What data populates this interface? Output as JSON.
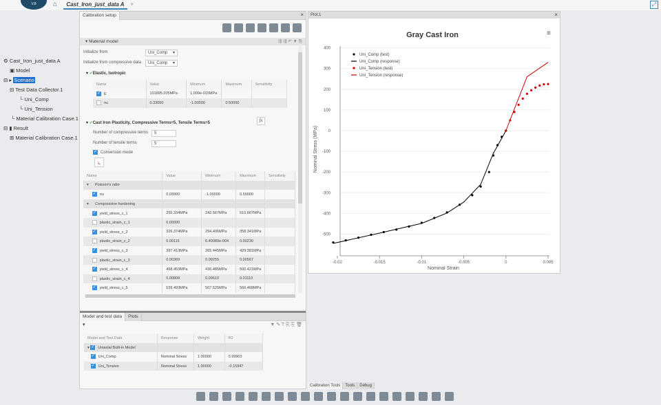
{
  "app": {
    "logo_text": "V.8",
    "doc_tab": "Cast_Iron_just_data A"
  },
  "tree": {
    "root": "Cast_Iron_just_data A",
    "items": [
      "Model",
      "Scenario",
      "Test Data Collector.1",
      "Uni_Comp",
      "Uni_Tension",
      "Material Calibration Case.1",
      "Result",
      "Material Calibration Case.1"
    ]
  },
  "calibration": {
    "tab": "Calibration setup",
    "section": "Material model",
    "init_from_label": "Initialize from",
    "init_from_value": "Uni_Comp",
    "init_comp_label": "Initialize from compressive data",
    "init_comp_value": "Uni_Comp",
    "elastic_title": "Elastic, Isotropic",
    "columns": [
      "Name",
      "Value",
      "Minimum",
      "Maximum",
      "Sensitivity"
    ],
    "elastic_rows": [
      {
        "name": "E",
        "value": "101895.205MPa",
        "min": "1.000e-015MPa",
        "max": "",
        "checked": true
      },
      {
        "name": "nu",
        "value": "0.33000",
        "min": "-1.00000",
        "max": "0.50000",
        "checked": false
      }
    ],
    "plasticity_title": "Cast Iron Plasticity, Compressive Terms=5, Tensile Terms=5",
    "fx": "fx",
    "n_comp_label": "Number of compressive terms",
    "n_comp": "5",
    "n_tens_label": "Number of tensile terms",
    "n_tens": "5",
    "conversion_label": "Conversion mode",
    "plast_rows": [
      {
        "group": "Poisson's ratio"
      },
      {
        "name": "nu",
        "value": "0.03900",
        "min": "-1.00000",
        "max": "0.50000",
        "checked": true
      },
      {
        "group": "Compressive hardening"
      },
      {
        "name": "yield_stress_c_1",
        "value": "255.334MPa",
        "min": "242.567MPa",
        "max": "510.667MPa",
        "checked": true
      },
      {
        "name": "plastic_strain_c_1",
        "value": "0.00000",
        "min": "",
        "max": "",
        "checked": false
      },
      {
        "name": "yield_stress_c_2",
        "value": "326.374MPa",
        "min": "294.406MPa",
        "max": "358.341MPa",
        "checked": true
      },
      {
        "name": "plastic_strain_c_2",
        "value": "0.00116",
        "min": "6.40089e-004",
        "max": "0.00230",
        "checked": false
      },
      {
        "name": "yield_stress_c_3",
        "value": "397.413MPa",
        "min": "365.445MPa",
        "max": "429.381MPa",
        "checked": true
      },
      {
        "name": "plastic_strain_c_3",
        "value": "0.00369",
        "min": "0.00255",
        "max": "0.00567",
        "checked": false
      },
      {
        "name": "yield_stress_c_4",
        "value": "468.453MPa",
        "min": "436.485MPa",
        "max": "500.421MPa",
        "checked": true
      },
      {
        "name": "plastic_strain_c_4",
        "value": "0.00808",
        "min": "0.00610",
        "max": "0.01110",
        "checked": false
      },
      {
        "name": "yield_stress_c_5",
        "value": "539.493MPa",
        "min": "507.525MPa",
        "max": "566.468MPa",
        "checked": true
      }
    ]
  },
  "testdata": {
    "tabs": [
      "Model and test data",
      "Plots"
    ],
    "columns": [
      "Model and Test Data",
      "Response",
      "Weight",
      "R2"
    ],
    "group": "Uniaxial Built-in Model",
    "rows": [
      {
        "name": "Uni_Comp",
        "response": "Nominal Stress",
        "weight": "1.00000",
        "r2": "0.99903"
      },
      {
        "name": "Uni_Tension",
        "response": "Nominal Stress",
        "weight": "1.00000",
        "r2": "-0.15947"
      }
    ]
  },
  "plot": {
    "tab": "Plot.1"
  },
  "bottom_tabs": [
    "Calibration Tools",
    "Tools",
    "Debug"
  ],
  "chart_data": {
    "type": "scatter",
    "title": "Gray Cast Iron",
    "xlabel": "Nominal Strain",
    "ylabel": "Nominal Stress (MPa)",
    "xlim": [
      -0.021,
      0.005
    ],
    "ylim": [
      -560,
      400
    ],
    "xticks": [
      "-0.02",
      "-0.015",
      "-0.01",
      "-0.005",
      "0",
      "0.005"
    ],
    "yticks": [
      "400",
      "300",
      "200",
      "100",
      "0",
      "-100",
      "-200",
      "-300",
      "-400",
      "-500"
    ],
    "legend_position": "top-left",
    "grid": true,
    "series": [
      {
        "name": "Uni_Comp (test)",
        "kind": "points",
        "color": "#000000",
        "x": [
          -0.0205,
          -0.019,
          -0.0175,
          -0.016,
          -0.0145,
          -0.013,
          -0.0115,
          -0.01,
          -0.0085,
          -0.007,
          -0.0055,
          -0.004,
          -0.003,
          -0.002,
          -0.0015,
          -0.001,
          -0.0005,
          0
        ],
        "y": [
          -540,
          -530,
          -517,
          -503,
          -490,
          -478,
          -463,
          -445,
          -422,
          -395,
          -358,
          -312,
          -270,
          -200,
          -120,
          -70,
          -30,
          0
        ]
      },
      {
        "name": "Uni_Comp (response)",
        "kind": "line",
        "color": "#000000",
        "x": [
          -0.0205,
          -0.015,
          -0.01,
          -0.007,
          -0.005,
          -0.003,
          -0.0015,
          0
        ],
        "y": [
          -545,
          -495,
          -448,
          -398,
          -345,
          -260,
          -110,
          0
        ]
      },
      {
        "name": "Uni_Tension (test)",
        "kind": "points",
        "color": "#cc0000",
        "x": [
          0,
          0.0005,
          0.001,
          0.0015,
          0.002,
          0.0025,
          0.003,
          0.0035,
          0.004,
          0.0045,
          0.005
        ],
        "y": [
          0,
          50,
          90,
          125,
          155,
          178,
          195,
          208,
          218,
          224,
          225
        ]
      },
      {
        "name": "Uni_Tension (response)",
        "kind": "line",
        "color": "#cc0000",
        "x": [
          0,
          0.0025,
          0.005
        ],
        "y": [
          0,
          260,
          330
        ]
      }
    ]
  }
}
